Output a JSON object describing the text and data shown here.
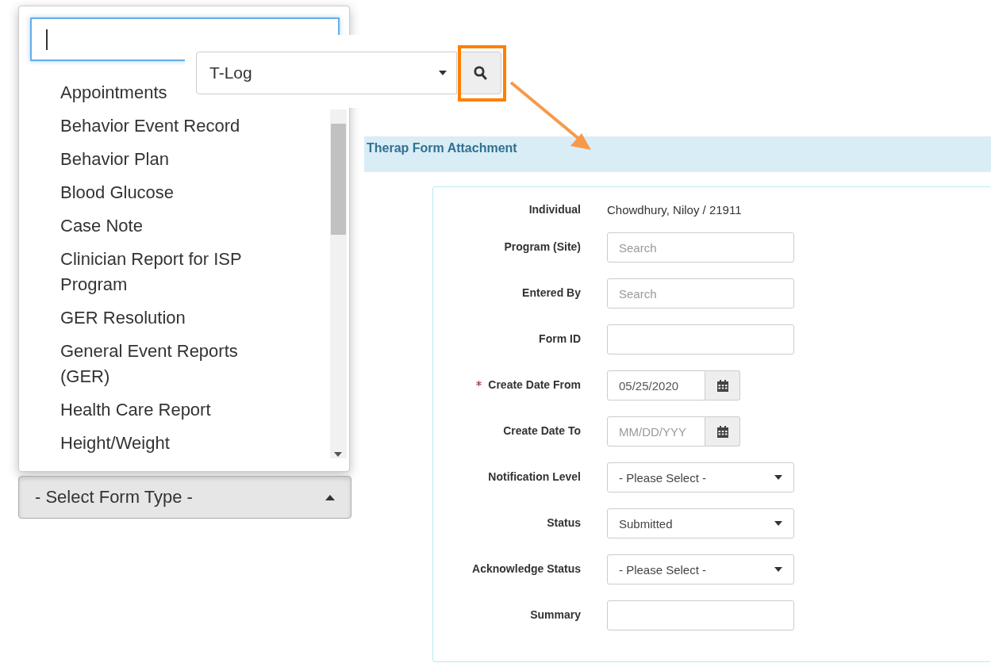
{
  "form_type_menu": {
    "items": [
      {
        "label": "Appointments"
      },
      {
        "label": "Behavior Event Record"
      },
      {
        "label": "Behavior Plan"
      },
      {
        "label": "Blood Glucose"
      },
      {
        "label": "Case Note"
      },
      {
        "label": "Clinician Report for ISP Program"
      },
      {
        "label": "GER Resolution"
      },
      {
        "label": "General Event Reports (GER)"
      },
      {
        "label": "Health Care Report"
      },
      {
        "label": "Height/Weight"
      }
    ],
    "button": {
      "label": "- Select Form Type -",
      "expanded": true
    }
  },
  "quick_search": {
    "select": "T-Log",
    "highlighted": true
  },
  "panel": {
    "title": "Therap Form Attachment"
  },
  "form": {
    "fields": [
      {
        "label": "Individual",
        "kind": "text",
        "value": "Chowdhury, Niloy / 21911"
      },
      {
        "label": "Program (Site)",
        "kind": "input",
        "placeholder": "Search"
      },
      {
        "label": "Entered By",
        "kind": "input",
        "placeholder": "Search"
      },
      {
        "label": "Form ID",
        "kind": "input"
      },
      {
        "label": "Create Date From",
        "kind": "date",
        "value": "05/25/2020",
        "required": true
      },
      {
        "label": "Create Date To",
        "kind": "date",
        "placeholder": "MM/DD/YYY"
      },
      {
        "label": "Notification Level",
        "kind": "select",
        "value": "- Please Select -"
      },
      {
        "label": "Status",
        "kind": "select",
        "value": "Submitted"
      },
      {
        "label": "Acknowledge Status",
        "kind": "select",
        "value": "- Please Select -"
      },
      {
        "label": "Summary",
        "kind": "input"
      }
    ]
  }
}
